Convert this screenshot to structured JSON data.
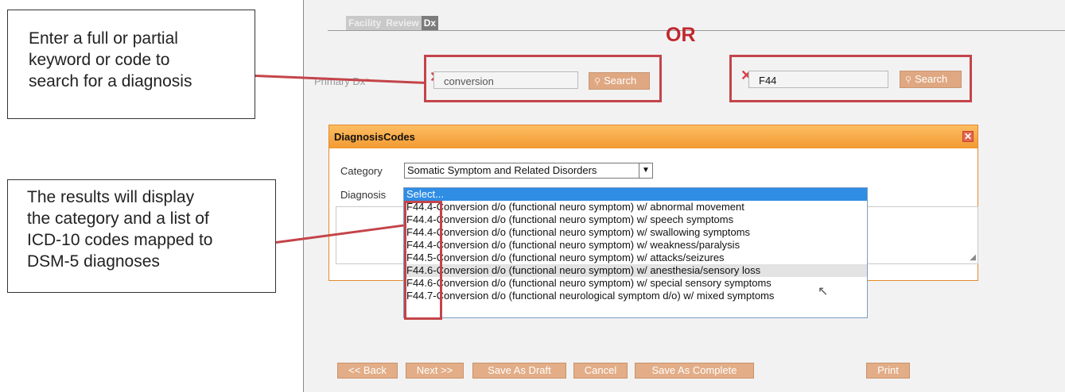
{
  "callouts": {
    "search_hint": "Enter a full or partial\nkeyword or code to\nsearch for a diagnosis",
    "results_hint": "The results will display\nthe category and a list of\nICD-10 codes mapped to\nDSM-5 diagnoses"
  },
  "tabs": [
    {
      "label": "Facility"
    },
    {
      "label": "Review"
    },
    {
      "label": "Dx"
    }
  ],
  "or_label": "OR",
  "primary_dx": {
    "label": "Primary Dx",
    "required_marker": "*"
  },
  "search1": {
    "value": "conversion",
    "button_label": "Search"
  },
  "search2": {
    "value": "F44",
    "button_label": "Search"
  },
  "dialog": {
    "title": "DiagnosisCodes",
    "close": "✕",
    "category_label": "Category",
    "category_value": "Somatic Symptom and Related Disorders",
    "diagnosis_label": "Diagnosis",
    "options": [
      "Select...",
      "F44.4-Conversion d/o (functional neuro symptom) w/ abnormal movement",
      "F44.4-Conversion d/o (functional neuro symptom) w/ speech symptoms",
      "F44.4-Conversion d/o (functional neuro symptom) w/ swallowing symptoms",
      "F44.4-Conversion d/o (functional neuro symptom) w/ weakness/paralysis",
      "F44.5-Conversion d/o (functional neuro symptom) w/ attacks/seizures",
      "F44.6-Conversion d/o (functional neuro symptom) w/ anesthesia/sensory loss",
      "F44.6-Conversion d/o (functional neuro symptom) w/ special sensory symptoms",
      "F44.7-Conversion d/o (functional neurological symptom d/o) w/ mixed symptoms"
    ]
  },
  "buttons": {
    "back": "<< Back",
    "next": "Next >>",
    "draft": "Save As Draft",
    "cancel": "Cancel",
    "complete": "Save As Complete",
    "print": "Print"
  },
  "colors": {
    "accent_red": "#c4444a",
    "dialog_orange": "#f29a30",
    "button_tan": "#e2ad87",
    "selected_blue": "#2f8de4"
  }
}
